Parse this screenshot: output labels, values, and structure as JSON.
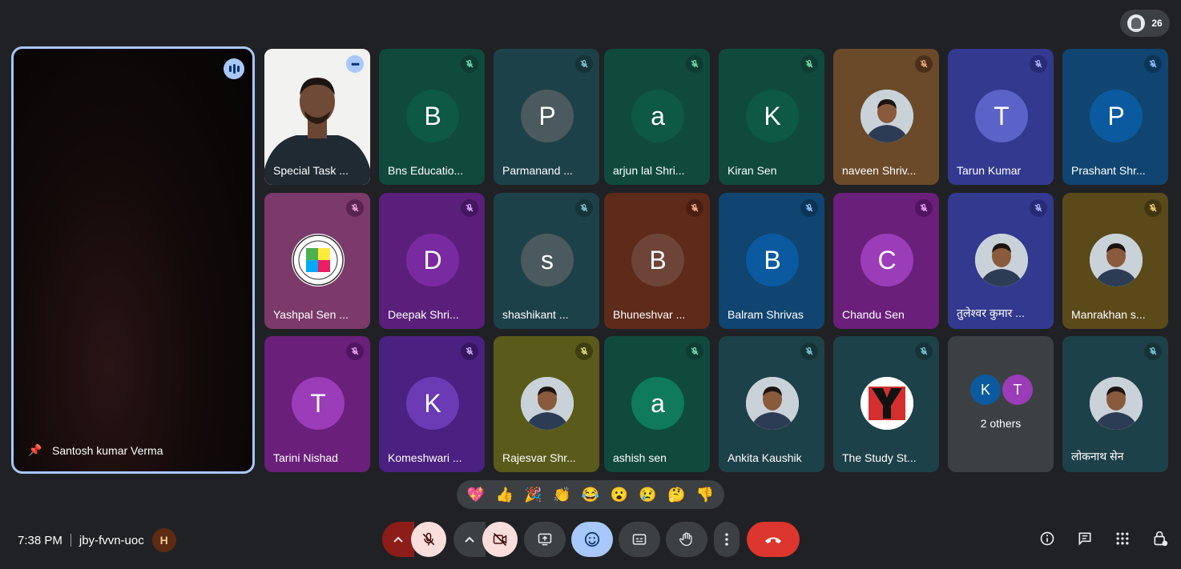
{
  "people_count": "26",
  "spotlight": {
    "name": "Santosh kumar Verma"
  },
  "tiles": [
    {
      "name": "Special Task ...",
      "type": "video"
    },
    {
      "name": "Bns Educatio...",
      "initial": "B",
      "bg": "#0f4a3c",
      "avatar_bg": "#0d5944",
      "mute_bg": "#0e3b32",
      "mute_color": "#6ee0b3"
    },
    {
      "name": "Parmanand ...",
      "initial": "P",
      "bg": "#1d4148",
      "avatar_bg": "#4b5a5e",
      "mute_bg": "#163338",
      "mute_color": "#7fc8d6"
    },
    {
      "name": "arjun lal Shri...",
      "initial": "a",
      "bg": "#0f4a3c",
      "avatar_bg": "#0d5944",
      "mute_bg": "#0e3b32",
      "mute_color": "#6ee0b3"
    },
    {
      "name": "Kiran Sen",
      "initial": "K",
      "bg": "#0f4a3c",
      "avatar_bg": "#0d5944",
      "mute_bg": "#0e3b32",
      "mute_color": "#6ee0b3"
    },
    {
      "name": "naveen Shriv...",
      "type": "photo",
      "bg": "#6b4a2a",
      "mute_bg": "#4a2f18",
      "mute_color": "#f2a67a"
    },
    {
      "name": "Tarun Kumar",
      "initial": "T",
      "bg": "#33398f",
      "avatar_bg": "#5b63c9",
      "mute_bg": "#262b73",
      "mute_color": "#aab3ff"
    },
    {
      "name": "Prashant Shr...",
      "initial": "P",
      "bg": "#0f4570",
      "avatar_bg": "#0b5aa0",
      "mute_bg": "#0c3457",
      "mute_color": "#8ec6ff"
    },
    {
      "name": "Yashpal Sen ...",
      "type": "emblem",
      "bg": "#7b3a6a",
      "mute_bg": "#5a2450",
      "mute_color": "#f0a6e0"
    },
    {
      "name": "Deepak Shri...",
      "initial": "D",
      "bg": "#5a1f7a",
      "avatar_bg": "#7a2aa0",
      "mute_bg": "#431660",
      "mute_color": "#e0a6ff"
    },
    {
      "name": "shashikant ...",
      "initial": "s",
      "bg": "#1d4148",
      "avatar_bg": "#4b5a5e",
      "mute_bg": "#163338",
      "mute_color": "#7fc8d6"
    },
    {
      "name": "Bhuneshvar ...",
      "initial": "B",
      "bg": "#5e2a1a",
      "avatar_bg": "#6e4438",
      "mute_bg": "#4a1e10",
      "mute_color": "#ffb59c"
    },
    {
      "name": "Balram Shrivas",
      "initial": "B",
      "bg": "#0f4570",
      "avatar_bg": "#0b5aa0",
      "mute_bg": "#0c3457",
      "mute_color": "#8ec6ff"
    },
    {
      "name": "Chandu Sen",
      "initial": "C",
      "bg": "#6a1f7a",
      "avatar_bg": "#9b3cb8",
      "mute_bg": "#4f1560",
      "mute_color": "#f0a6ff"
    },
    {
      "name": "तुलेश्वर कुमार ...",
      "type": "photo",
      "bg": "#33398f",
      "mute_bg": "#262b73",
      "mute_color": "#aab3ff"
    },
    {
      "name": "Manrakhan s...",
      "type": "photo",
      "bg": "#5a4a1a",
      "mute_bg": "#42360f",
      "mute_color": "#f2d27a"
    },
    {
      "name": "Tarini Nishad",
      "initial": "T",
      "bg": "#6a1f7a",
      "avatar_bg": "#9b3cb8",
      "mute_bg": "#4f1560",
      "mute_color": "#f0a6ff"
    },
    {
      "name": "Komeshwari ...",
      "initial": "K",
      "bg": "#4a2080",
      "avatar_bg": "#6b3ab5",
      "mute_bg": "#371660",
      "mute_color": "#d2b0ff"
    },
    {
      "name": "Rajesvar Shr...",
      "type": "photo",
      "bg": "#5a5a1a",
      "mute_bg": "#3e3e0f",
      "mute_color": "#e8e07a"
    },
    {
      "name": "ashish sen",
      "initial": "a",
      "bg": "#0f4a3c",
      "avatar_bg": "#0f7a5c",
      "mute_bg": "#0e3b32",
      "mute_color": "#6ee0b3"
    },
    {
      "name": "Ankita Kaushik",
      "type": "photo",
      "bg": "#1d4148",
      "mute_bg": "#163338",
      "mute_color": "#7fc8d6"
    },
    {
      "name": "The Study St...",
      "type": "ylogo",
      "bg": "#1d4148",
      "mute_bg": "#163338",
      "mute_color": "#7fc8d6"
    },
    {
      "name": "2 others",
      "type": "others",
      "bg": "#3c4043",
      "others": [
        "K",
        "T"
      ]
    },
    {
      "name": "लोकनाथ सेन",
      "type": "photo",
      "bg": "#1d4148",
      "mute_bg": "#163338",
      "mute_color": "#7fc8d6"
    }
  ],
  "reactions": [
    "💖",
    "👍",
    "🎉",
    "👏",
    "😂",
    "😮",
    "😢",
    "🤔",
    "👎"
  ],
  "footer": {
    "time": "7:38 PM",
    "meeting_code": "jby-fvvn-uoc"
  },
  "colors": {
    "accent": "#a8c7fa",
    "end_call": "#dc362e",
    "muted_bg": "#f9dedc"
  }
}
